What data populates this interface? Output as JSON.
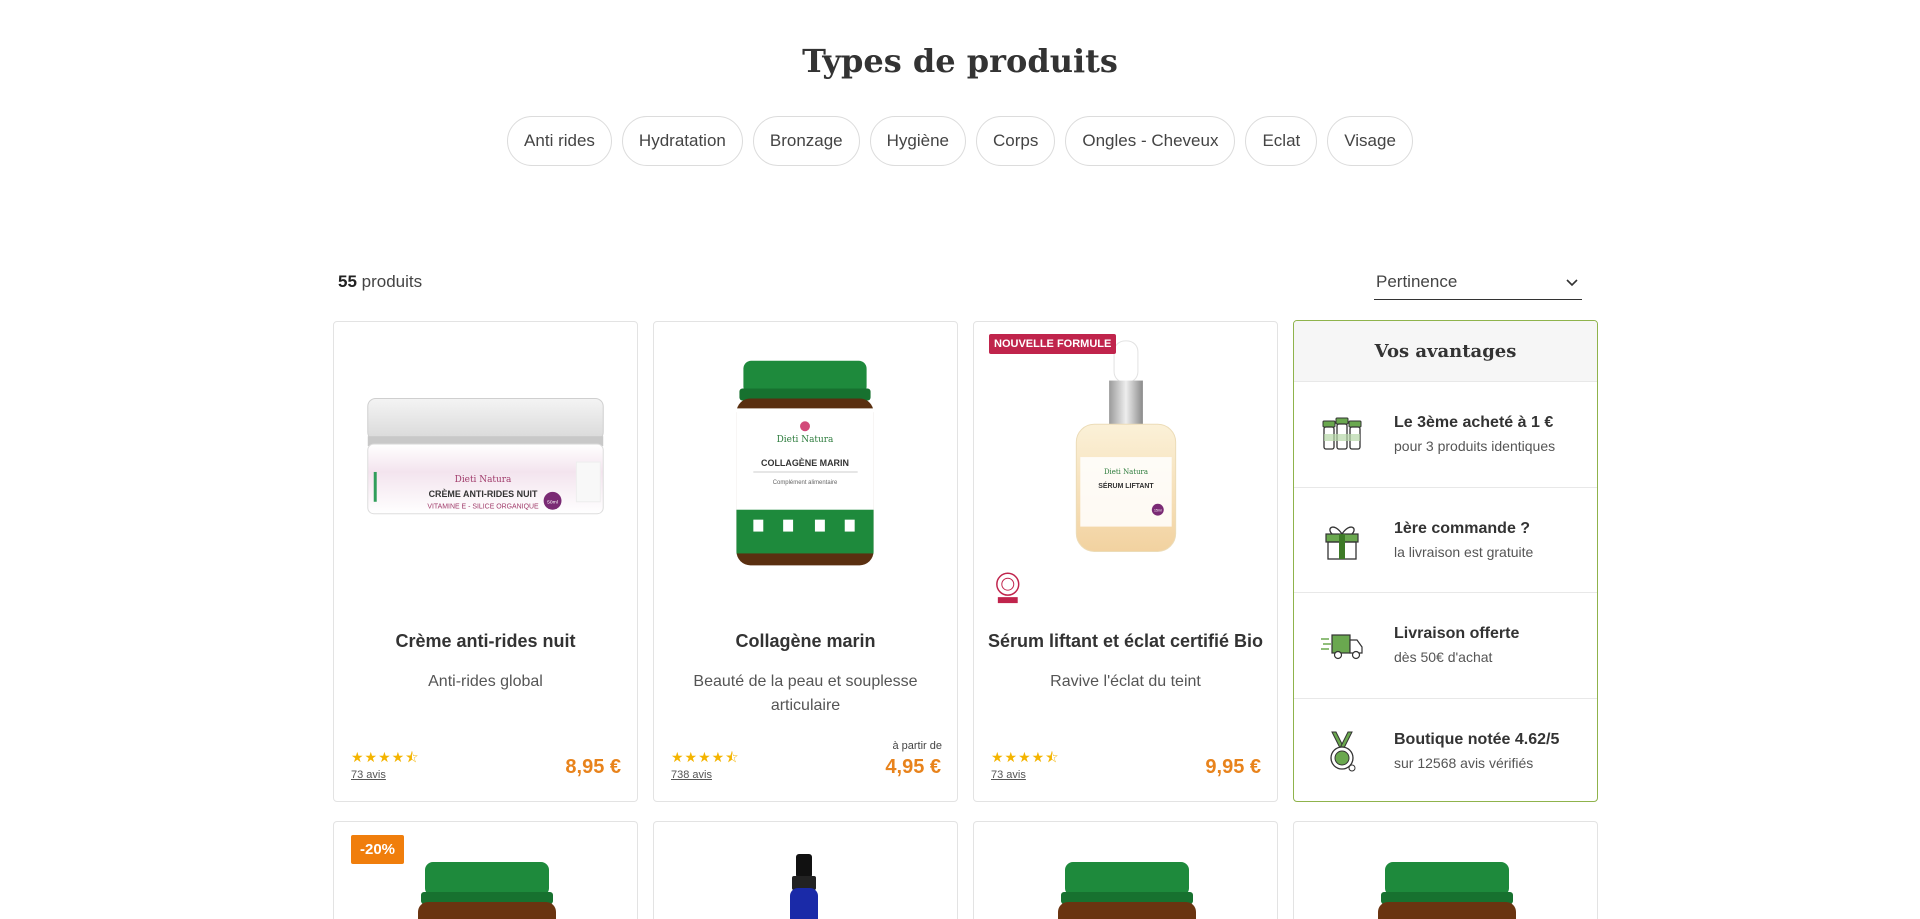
{
  "page_title": "Types de produits",
  "categories": [
    "Anti rides",
    "Hydratation",
    "Bronzage",
    "Hygiène",
    "Corps",
    "Ongles - Cheveux",
    "Eclat",
    "Visage"
  ],
  "listing": {
    "count_number": "55",
    "count_label": "produits",
    "sort_value": "Pertinence"
  },
  "products": [
    {
      "name": "Crème anti-rides nuit",
      "subtitle": "Anti-rides global",
      "stars": "★★★★⯪",
      "reviews": "73 avis",
      "price": "8,95 €",
      "label_brand": "Dieti Natura",
      "label_product": "CRÈME ANTI-RIDES NUIT",
      "label_sub": "VITAMINE E - SILICE ORGANIQUE",
      "label_volume": "50ml"
    },
    {
      "name": "Collagène marin",
      "subtitle": "Beauté de la peau et souplesse articulaire",
      "stars": "★★★★⯪",
      "reviews": "738 avis",
      "price_prefix": "à partir de",
      "price": "4,95 €",
      "label_brand": "Dieti Natura",
      "label_product": "COLLAGÈNE MARIN",
      "label_sub": "Complément alimentaire"
    },
    {
      "name": "Sérum liftant et éclat certifié Bio",
      "subtitle": "Ravive l'éclat du teint",
      "stars": "★★★★⯪",
      "reviews": "73 avis",
      "price": "9,95 €",
      "badge": "NOUVELLE FORMULE",
      "label_brand": "Dieti Natura",
      "label_product": "SÉRUM LIFTANT",
      "label_volume": "15ml"
    }
  ],
  "second_row": {
    "discount_badge": "-20%"
  },
  "advantages": {
    "title": "Vos avantages",
    "items": [
      {
        "main": "Le 3ème acheté à 1 €",
        "sub": "pour 3 produits identiques",
        "icon": "jars-icon"
      },
      {
        "main": "1ère commande ?",
        "sub": "la livraison est gratuite",
        "icon": "gift-icon"
      },
      {
        "main": "Livraison offerte",
        "sub": "dès 50€ d'achat",
        "icon": "delivery-truck-icon"
      },
      {
        "main": "Boutique notée 4.62/5",
        "sub": "sur 12568 avis vérifiés",
        "icon": "medal-icon"
      }
    ]
  },
  "colors": {
    "accent_price": "#e8831c",
    "badge_new": "#c0244c",
    "badge_discount": "#f07e0c",
    "advantages_border": "#8fb34c",
    "jar_lid_green": "#1e8a3c",
    "star_yellow": "#f4b400"
  }
}
